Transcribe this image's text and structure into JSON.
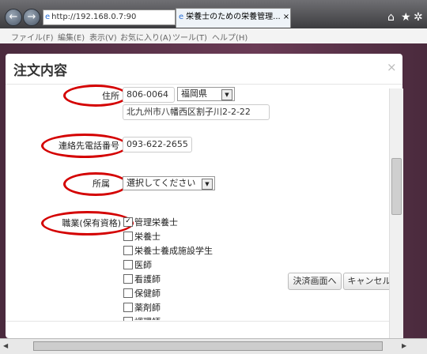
{
  "browser": {
    "address": "http://192.168.0.7:90",
    "tab_title": "栄養士のための栄養管理...",
    "menu": [
      "ファイル(F)",
      "編集(E)",
      "表示(V)",
      "お気に入り(A)",
      "ツール(T)",
      "ヘルプ(H)"
    ]
  },
  "modal": {
    "title": "注文内容",
    "close": "×",
    "address_label": "住所",
    "postal_code": "806-0064",
    "prefecture": "福岡県",
    "street": "北九州市八幡西区割子川2-2-22",
    "phone_label": "連絡先電話番号",
    "phone": "093-622-2655",
    "affiliation_label": "所属",
    "affiliation_placeholder": "選択してください",
    "occupation_label": "職業(保有資格)",
    "occupations": [
      {
        "label": "管理栄養士",
        "checked": true
      },
      {
        "label": "栄養士",
        "checked": false
      },
      {
        "label": "栄養士養成施設学生",
        "checked": false
      },
      {
        "label": "医師",
        "checked": false
      },
      {
        "label": "看護師",
        "checked": false
      },
      {
        "label": "保健師",
        "checked": false
      },
      {
        "label": "薬剤師",
        "checked": false
      },
      {
        "label": "調理師",
        "checked": false
      }
    ],
    "payment_button": "決済画面へ",
    "cancel_button": "キャンセル"
  },
  "colors": {
    "annotation": "#d40000"
  }
}
